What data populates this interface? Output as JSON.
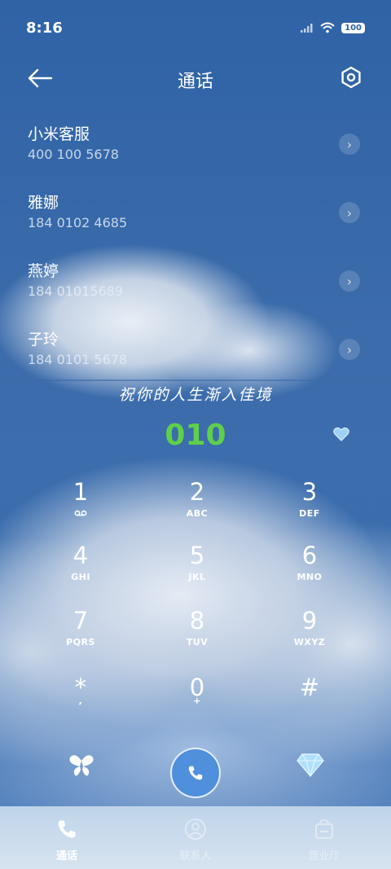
{
  "status_bar": {
    "time": "8:16",
    "battery": "100"
  },
  "header": {
    "title": "通话"
  },
  "contacts": [
    {
      "name": "小米客服",
      "number": "400 100 5678"
    },
    {
      "name": "雅娜",
      "number": "184 0102 4685"
    },
    {
      "name": "燕婷",
      "number": "184 01015689"
    },
    {
      "name": "子玲",
      "number": "184 0101 5678"
    }
  ],
  "slogan": "祝你的人生渐入佳境",
  "dialed_number": "010",
  "keypad": [
    {
      "digit": "1",
      "letters": ""
    },
    {
      "digit": "2",
      "letters": "ABC"
    },
    {
      "digit": "3",
      "letters": "DEF"
    },
    {
      "digit": "4",
      "letters": "GHI"
    },
    {
      "digit": "5",
      "letters": "JKL"
    },
    {
      "digit": "6",
      "letters": "MNO"
    },
    {
      "digit": "7",
      "letters": "PQRS"
    },
    {
      "digit": "8",
      "letters": "TUV"
    },
    {
      "digit": "9",
      "letters": "WXYZ"
    },
    {
      "digit": "*",
      "letters": ","
    },
    {
      "digit": "0",
      "letters": "+"
    },
    {
      "digit": "#",
      "letters": ""
    }
  ],
  "tabs": [
    {
      "label": "通话",
      "icon": "phone-icon",
      "active": true
    },
    {
      "label": "联系人",
      "icon": "contacts-icon",
      "active": false
    },
    {
      "label": "营业厅",
      "icon": "service-hall-icon",
      "active": false
    }
  ],
  "colors": {
    "accent_green": "#5ed04a",
    "call_blue": "#4f8fdc"
  }
}
